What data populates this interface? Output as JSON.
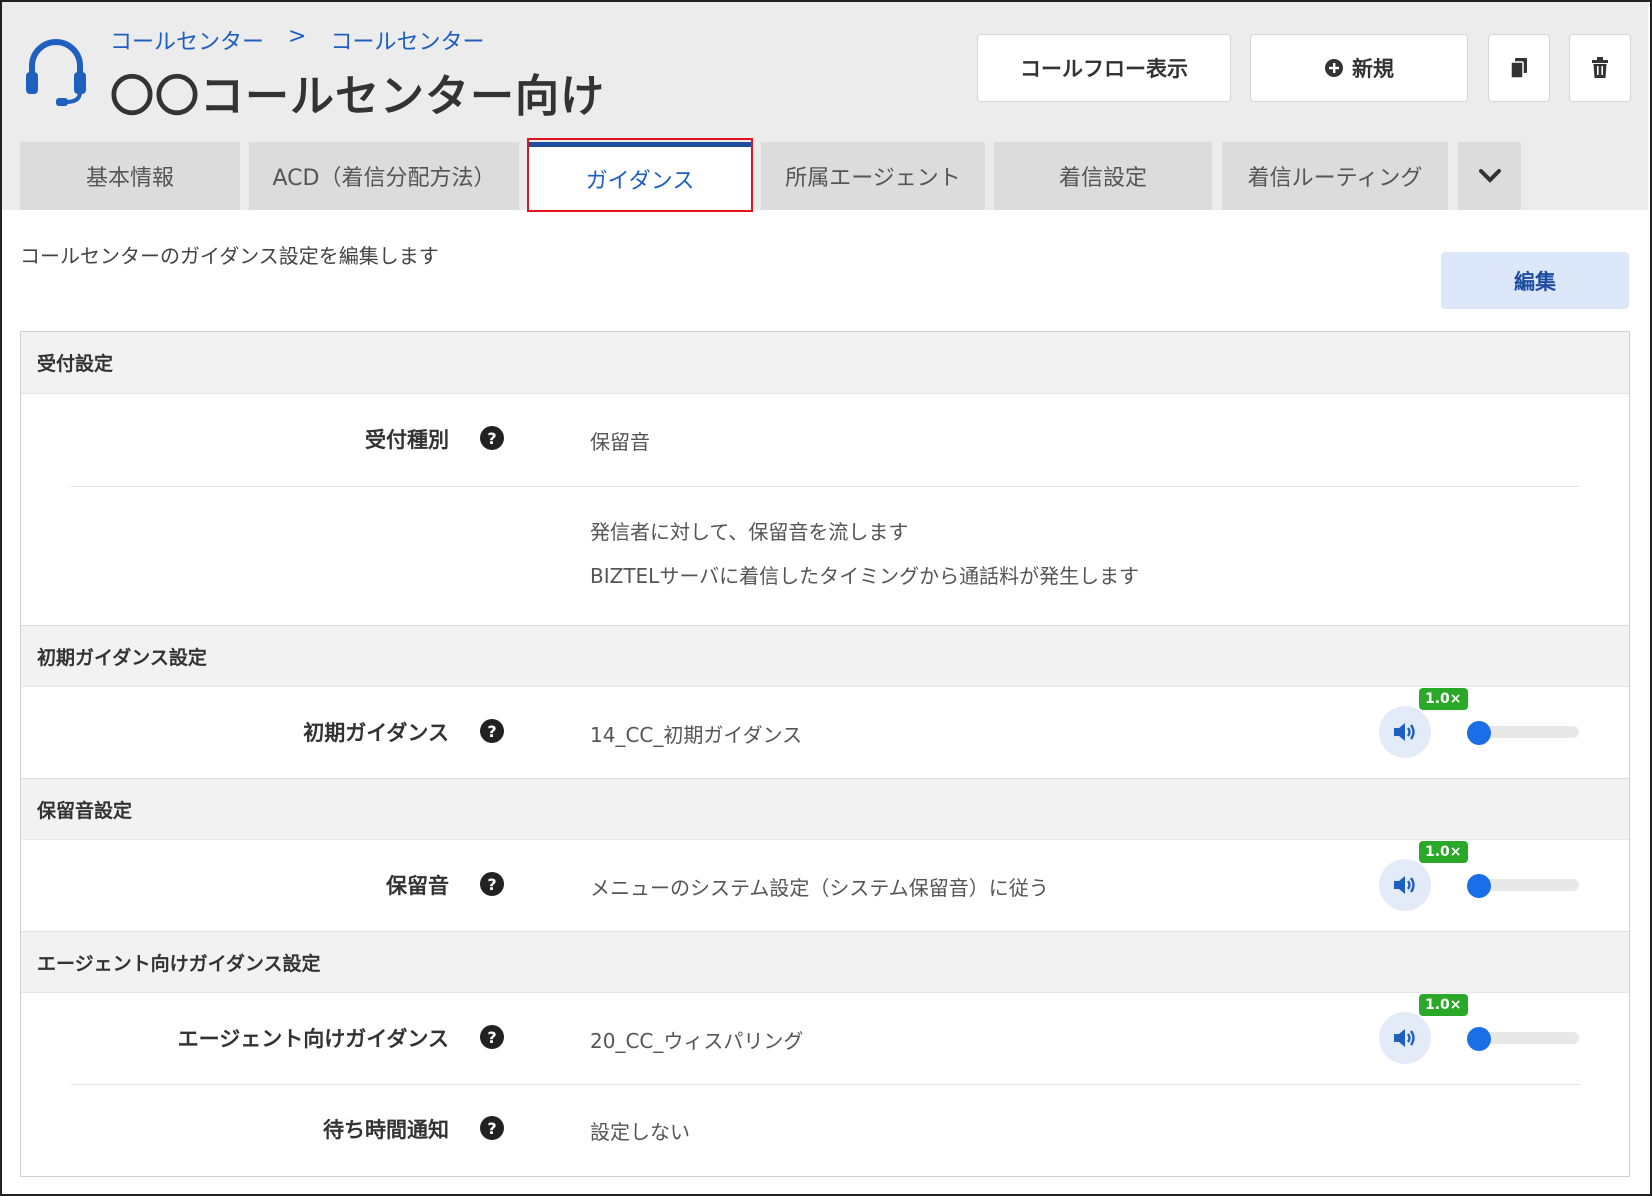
{
  "breadcrumb": {
    "level1": "コールセンター",
    "separator": ">",
    "level2": "コールセンター"
  },
  "page": {
    "title": "〇〇コールセンター向け"
  },
  "toolbar": {
    "callflow_label": "コールフロー表示",
    "new_label": "新規"
  },
  "tabs": [
    {
      "label": "基本情報",
      "active": false
    },
    {
      "label": "ACD（着信分配方法）",
      "active": false
    },
    {
      "label": "ガイダンス",
      "active": true
    },
    {
      "label": "所属エージェント",
      "active": false
    },
    {
      "label": "着信設定",
      "active": false
    },
    {
      "label": "着信ルーティング",
      "active": false
    }
  ],
  "description": "コールセンターのガイダンス設定を編集します",
  "edit_label": "編集",
  "sections": {
    "reception": {
      "title": "受付設定",
      "rows": [
        {
          "label": "受付種別",
          "value": "保留音"
        }
      ],
      "notes": [
        "発信者に対して、保留音を流します",
        "BIZTELサーバに着信したタイミングから通話料が発生します"
      ]
    },
    "initial": {
      "title": "初期ガイダンス設定",
      "rows": [
        {
          "label": "初期ガイダンス",
          "value": "14_CC_初期ガイダンス",
          "speed": "1.0×"
        }
      ]
    },
    "hold": {
      "title": "保留音設定",
      "rows": [
        {
          "label": "保留音",
          "value": "メニューのシステム設定（システム保留音）に従う",
          "speed": "1.0×"
        }
      ]
    },
    "agent": {
      "title": "エージェント向けガイダンス設定",
      "rows": [
        {
          "label": "エージェント向けガイダンス",
          "value": "20_CC_ウィスパリング",
          "speed": "1.0×"
        },
        {
          "label": "待ち時間通知",
          "value": "設定しない"
        }
      ]
    }
  },
  "help_glyph": "?",
  "colors": {
    "accent": "#1f5fbf",
    "active_tab_border": "#1f4e9f",
    "highlight": "#e0141e",
    "speed_badge": "#2aa827",
    "slider_knob": "#1a6ee8"
  },
  "icons": [
    "headset-icon",
    "plus-circle-icon",
    "copy-icon",
    "trash-icon",
    "chevron-down-icon",
    "help-icon",
    "volume-icon"
  ]
}
